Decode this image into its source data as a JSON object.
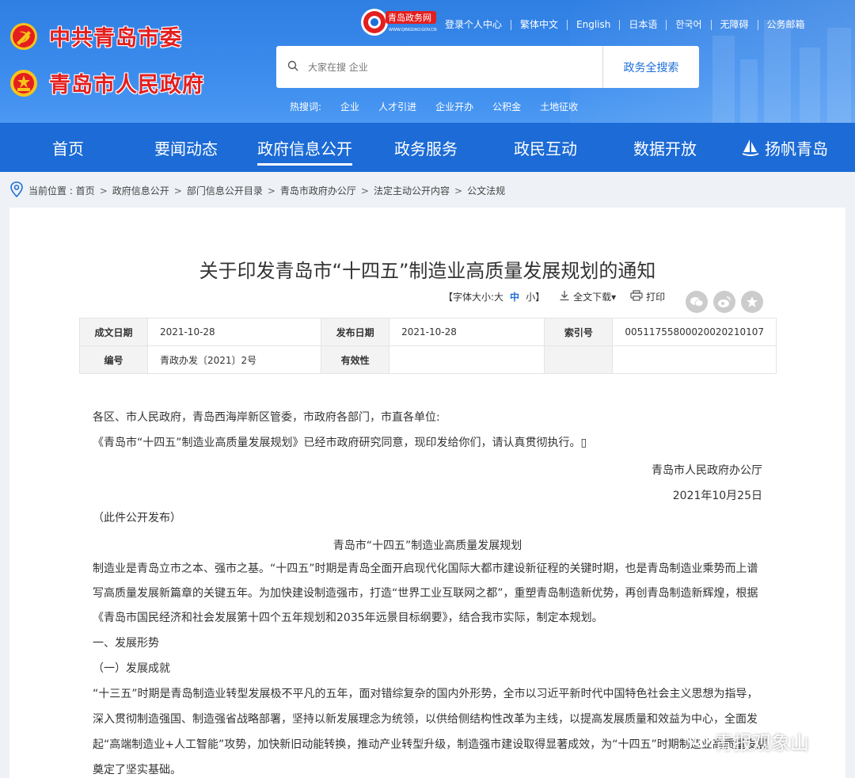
{
  "header": {
    "party_name": "中共青岛市委",
    "gov_name": "青岛市人民政府",
    "gov_logo_text": "青岛政务网",
    "gov_logo_url_text": "WWW.QINGDAO.GOV.CN",
    "top_links": [
      "登录个人中心",
      "繁体中文",
      "English",
      "日本语",
      "한국어",
      "无障碍",
      "公务邮箱"
    ],
    "search_placeholder": "大家在搜 企业",
    "search_button": "政务全搜索",
    "hot_label": "热搜词:",
    "hot_words": [
      "企业",
      "人才引进",
      "企业开办",
      "公积金",
      "土地征收"
    ]
  },
  "nav": {
    "items": [
      "首页",
      "要闻动态",
      "政府信息公开",
      "政务服务",
      "政民互动",
      "数据开放",
      "扬帆青岛"
    ],
    "active_index": 2
  },
  "breadcrumb": {
    "label": "当前位置 : 首页",
    "items": [
      "政府信息公开",
      "部门信息公开目录",
      "青岛市政府办公厅",
      "法定主动公开内容",
      "公文法规"
    ]
  },
  "article": {
    "title": "关于印发青岛市“十四五”制造业高质量发展规划的通知",
    "font_size_label": "【字体大小:大",
    "font_size_mid": "中",
    "font_size_small": "小】",
    "download_label": "全文下载▾",
    "print_label": "打印",
    "meta": {
      "row1": [
        {
          "k": "成文日期",
          "v": "2021-10-28"
        },
        {
          "k": "发布日期",
          "v": "2021-10-28"
        },
        {
          "k": "索引号",
          "v": "00511755800020020210107"
        }
      ],
      "row2": [
        {
          "k": "编号",
          "v": "青政办发〔2021〕2号"
        },
        {
          "k": "有效性",
          "v": ""
        }
      ]
    },
    "salutation": "各区、市人民政府，青岛西海岸新区管委，市政府各部门，市直各单位:",
    "notice": "《青岛市“十四五”制造业高质量发展规划》已经市政府研究同意，现印发给你们，请认真贯彻执行。▯",
    "signer": "青岛市人民政府办公厅",
    "date": "2021年10月25日",
    "publish_note": "（此件公开发布）",
    "plan_title": "青岛市“十四五”制造业高质量发展规划",
    "para1": [
      "制造业是青岛立市之本、强市之基。“十四五”时期是青岛全面开启现代化国际大都市建设新征程的关键时期，也是青岛制造业乘势而上谱",
      "写高质量发展新篇章的关键五年。为加快建设制造强市，打造“世界工业互联网之都”，重塑青岛制造新优势，再创青岛制造新辉煌，根据",
      "《青岛市国民经济和社会发展第十四个五年规划和2035年远景目标纲要》，结合我市实际，制定本规划。"
    ],
    "section1": "一、发展形势",
    "section1_1": "（一）发展成就",
    "para2": [
      "“十三五”时期是青岛制造业转型发展极不平凡的五年，面对错综复杂的国内外形势，全市以习近平新时代中国特色社会主义思想为指导，",
      "深入贯彻制造强国、制造强省战略部署，坚持以新发展理念为统领，以供给侧结构性改革为主线，以提高发展质量和效益为中心，全面发",
      "起“高端制造业+人工智能”攻势，加快新旧动能转换，推动产业转型升级，制造强市建设取得显著成效，为“十四五”时期制造业高质量发展",
      "奠定了坚实基础。"
    ]
  },
  "watermark": "青报观象山"
}
